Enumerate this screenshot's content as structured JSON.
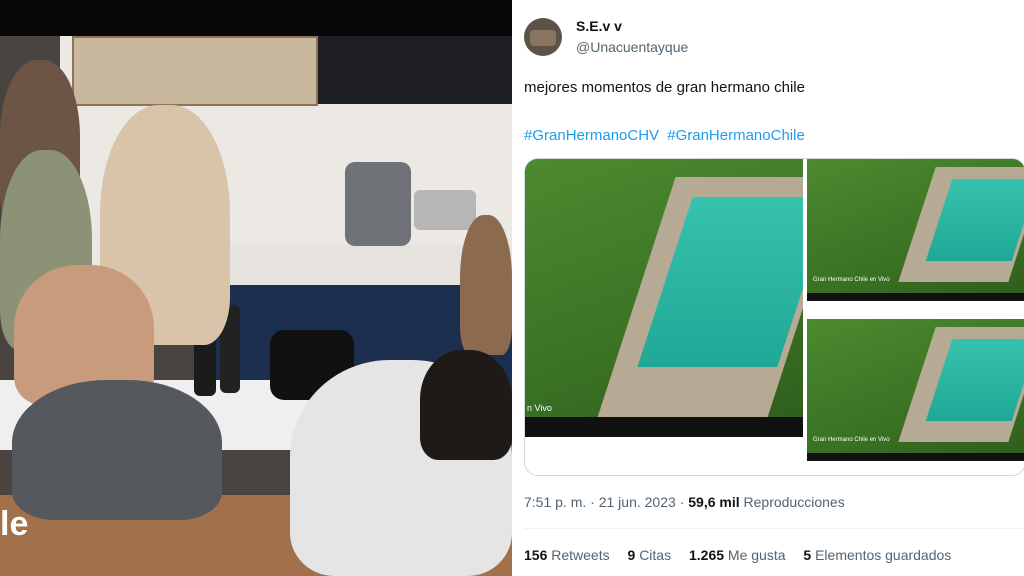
{
  "photo": {
    "overlay_text": "le"
  },
  "tweet": {
    "display_name": "S.E.v v",
    "handle": "@Unacuentayque",
    "text": "mejores momentos de gran hermano chile",
    "hashtags": [
      "#GranHermanoCHV",
      "#GranHermanoChile"
    ],
    "media": {
      "main_caption": "n Vivo",
      "thumb_top_caption": "Gran Hermano Chile en Vivo",
      "thumb_bottom_caption": "Gran Hermano Chile en Vivo"
    },
    "time": "7:51 p. m.",
    "separator": "·",
    "date": "21 jun. 2023",
    "views_count": "59,6 mil",
    "views_label": "Reproducciones",
    "stats": [
      {
        "count": "156",
        "label": "Retweets"
      },
      {
        "count": "9",
        "label": "Citas"
      },
      {
        "count": "1.265",
        "label": "Me gusta"
      },
      {
        "count": "5",
        "label": "Elementos guardados"
      }
    ]
  }
}
